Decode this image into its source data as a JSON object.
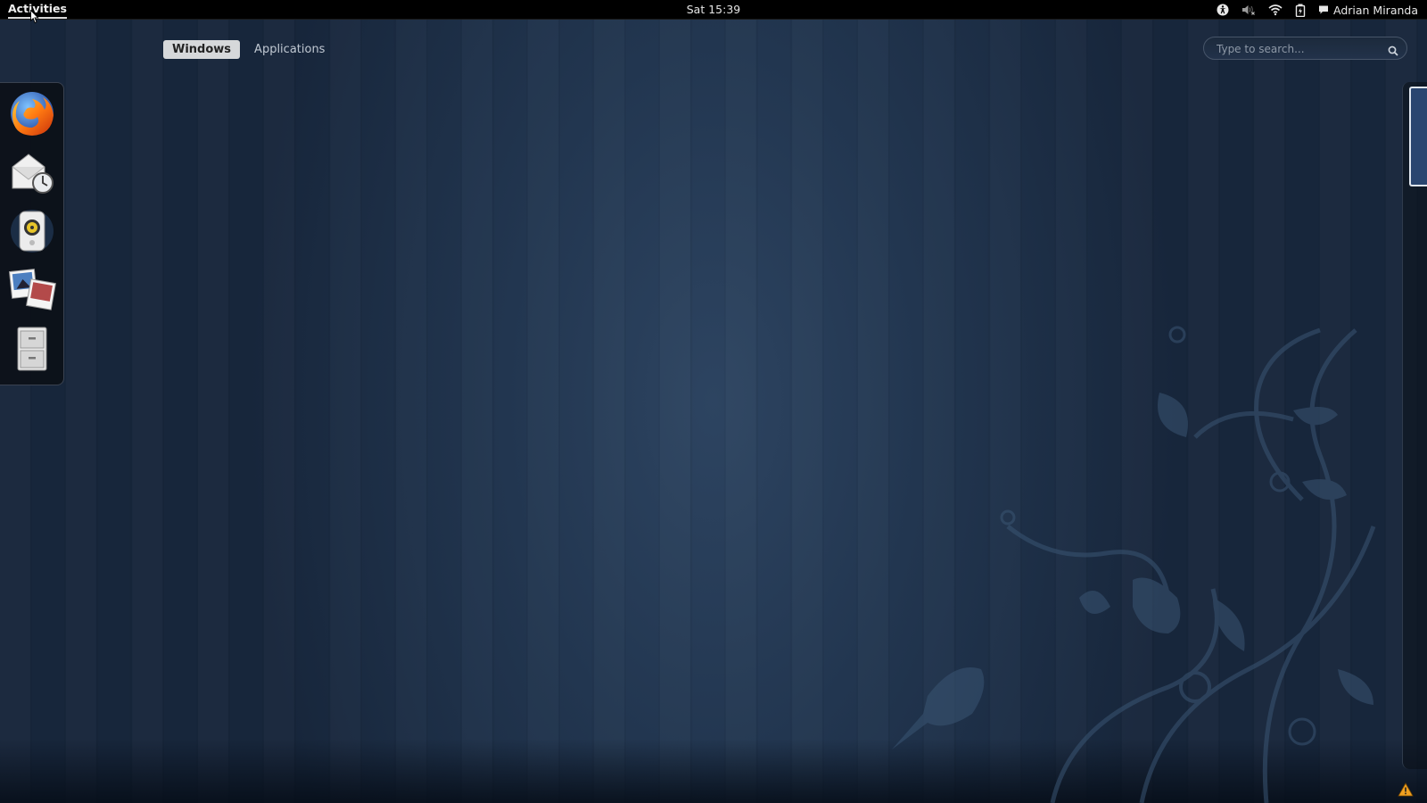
{
  "topbar": {
    "activities": "Activities",
    "clock": "Sat 15:39",
    "user": "Adrian Miranda"
  },
  "view_selector": {
    "windows": "Windows",
    "applications": "Applications"
  },
  "search": {
    "placeholder": "Type to search..."
  },
  "dash": {
    "items": [
      {
        "icon": "firefox-icon"
      },
      {
        "icon": "evolution-mail-icon"
      },
      {
        "icon": "rhythmbox-icon"
      },
      {
        "icon": "shotwell-photos-icon"
      },
      {
        "icon": "files-cabinet-icon"
      }
    ]
  },
  "colors": {
    "topbar": "#000000",
    "background": "#223650",
    "active_tab": "#d6d8da"
  }
}
